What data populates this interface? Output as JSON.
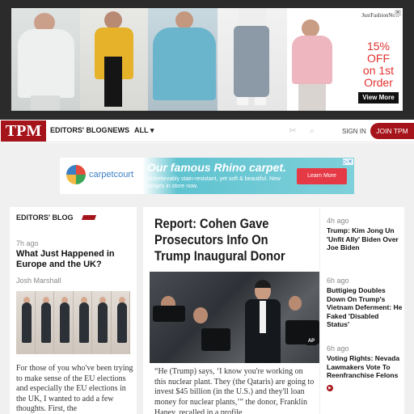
{
  "top_ad": {
    "brand": "JustFashionNow",
    "offer_line1": "15% OFF",
    "offer_line2": "on 1st",
    "offer_line3": "Order",
    "cta": "View More"
  },
  "nav": {
    "logo": "TPM",
    "items": [
      "EDITORS' BLOG",
      "NEWS",
      "ALL"
    ],
    "all_caret": "▾",
    "signin": "SIGN IN",
    "join": "JOIN TPM"
  },
  "banner_ad": {
    "brand": "carpetcourt",
    "headline": "Our famous Rhino carpet.",
    "subline": "Unbelievably stain-resistant, yet soft & beautiful. New ranges in store now.",
    "cta": "Learn More"
  },
  "editors_blog": {
    "heading": "EDITORS' BLOG",
    "time": "7h ago",
    "title": "What Just Happened in Europe and the UK?",
    "author": "Josh Marshall",
    "body": "For those of you who've been trying to make sense of the EU elections and especially the EU elections in the UK, I wanted to add a few thoughts. First, the"
  },
  "lead_story": {
    "title": "Report: Cohen Gave Prosecutors Info On Trump Inaugural Donor",
    "image_badge": "AP",
    "body": "“He (Trump) says, ‘I know you're working on this nuclear plant. They (the Qataris) are going to invest $45 billion (in the U.S.) and they'll loan money for nuclear plants,’” the donor, Franklin Haney, recalled in a profile"
  },
  "right_rail": [
    {
      "time": "4h ago",
      "title": "Trump: Kim Jong Un 'Unfit Ally' Biden Over Joe Biden"
    },
    {
      "time": "6h ago",
      "title": "Buttigieg Doubles Down On Trump's Vietnam Deferment: He Faked 'Disabled Status'"
    },
    {
      "time": "6h ago",
      "title": "Voting Rights: Nevada Lawmakers Vote To Reenfranchise Felons"
    }
  ]
}
